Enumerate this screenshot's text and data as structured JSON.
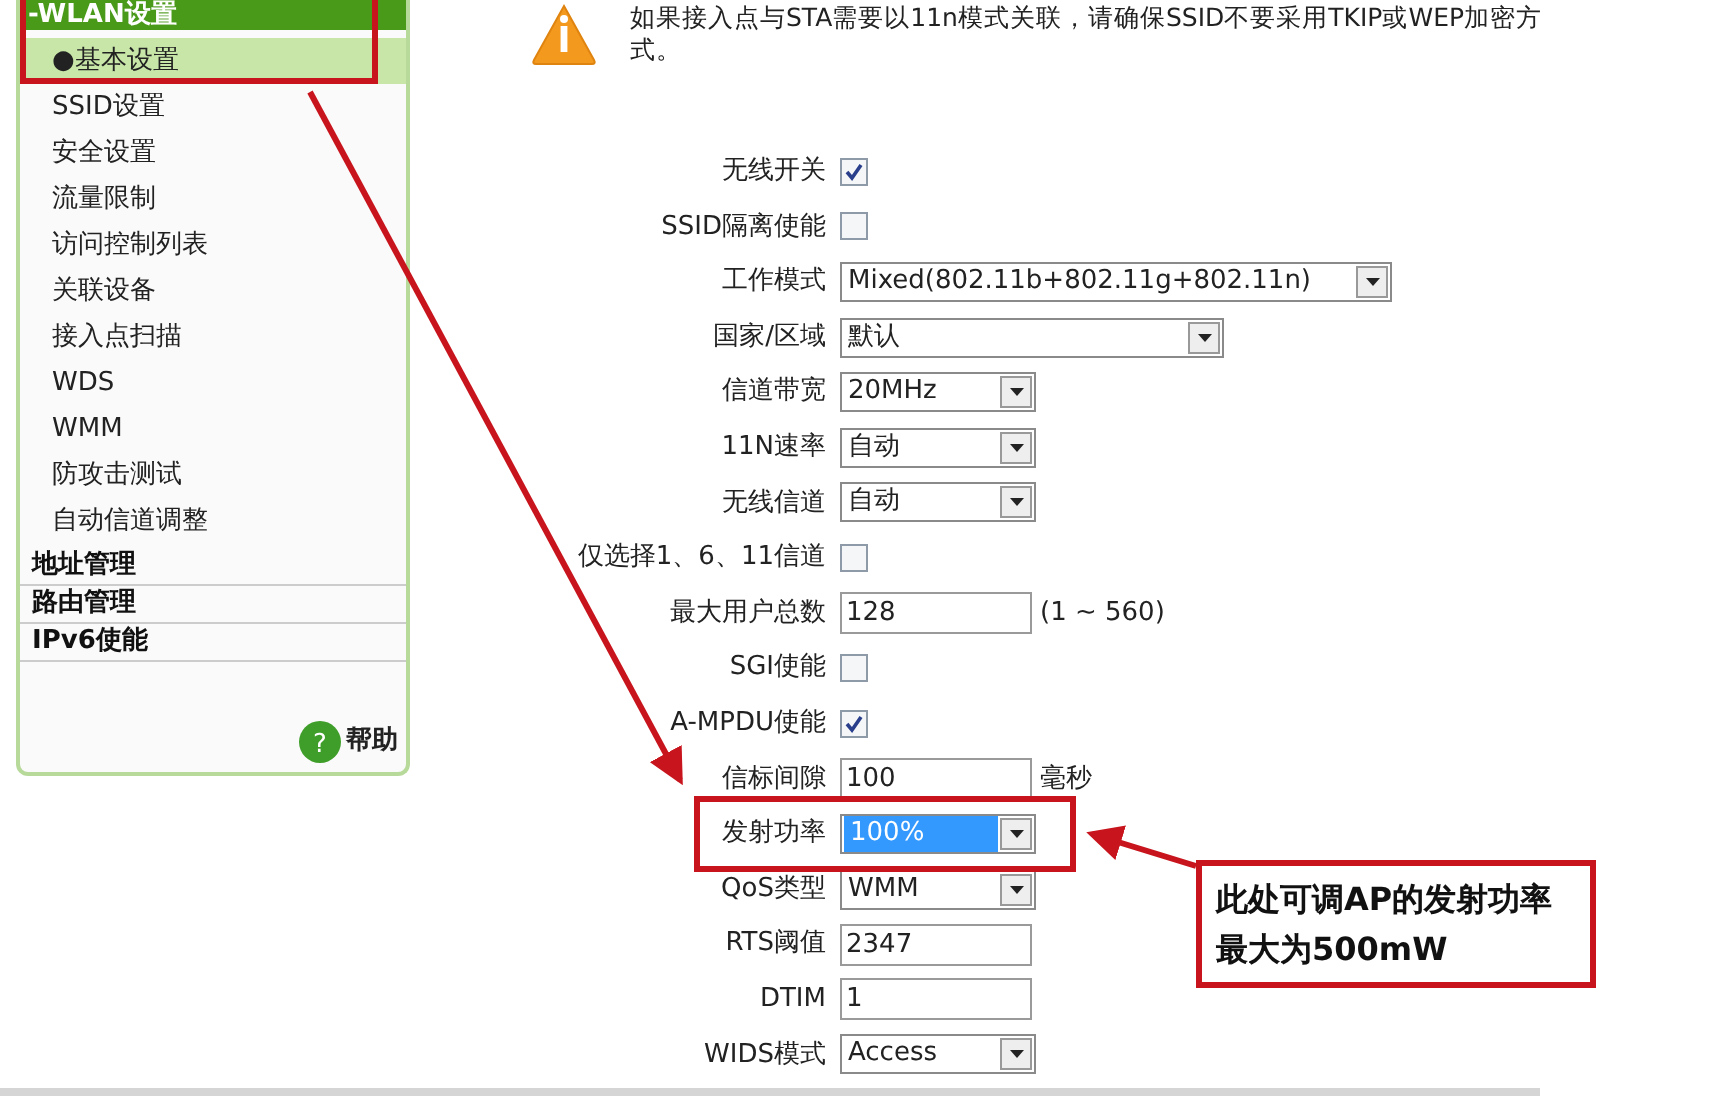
{
  "sidebar": {
    "header": "-WLAN设置",
    "items": [
      {
        "label": "●基本设置",
        "selected": true
      },
      {
        "label": "SSID设置",
        "selected": false
      },
      {
        "label": "安全设置",
        "selected": false
      },
      {
        "label": "流量限制",
        "selected": false
      },
      {
        "label": "访问控制列表",
        "selected": false
      },
      {
        "label": "关联设备",
        "selected": false
      },
      {
        "label": "接入点扫描",
        "selected": false
      },
      {
        "label": "WDS",
        "selected": false
      },
      {
        "label": "WMM",
        "selected": false
      },
      {
        "label": "防攻击测试",
        "selected": false
      },
      {
        "label": "自动信道调整",
        "selected": false
      }
    ],
    "sections": [
      "地址管理",
      "路由管理",
      "IPv6使能"
    ],
    "help_glyph": "?",
    "help": "帮助"
  },
  "notice": "如果接入点与STA需要以11n模式关联，请确保SSID不要采用TKIP或WEP加密方式。",
  "fields": [
    {
      "kind": "checkbox",
      "label": "无线开关",
      "checked": true
    },
    {
      "kind": "checkbox",
      "label": "SSID隔离使能",
      "checked": false
    },
    {
      "kind": "select",
      "label": "工作模式",
      "value": "Mixed(802.11b+802.11g+802.11n)",
      "focused": false
    },
    {
      "kind": "select",
      "label": "国家/区域",
      "value": "默认",
      "focused": false
    },
    {
      "kind": "select",
      "label": "信道带宽",
      "value": "20MHz",
      "focused": false
    },
    {
      "kind": "select",
      "label": "11N速率",
      "value": "自动",
      "focused": false
    },
    {
      "kind": "select",
      "label": "无线信道",
      "value": "自动",
      "focused": false
    },
    {
      "kind": "checkbox",
      "label": "仅选择1、6、11信道",
      "checked": false
    },
    {
      "kind": "text",
      "label": "最大用户总数",
      "value": "128",
      "suffix": "(1 ~ 560)"
    },
    {
      "kind": "checkbox",
      "label": "SGI使能",
      "checked": false
    },
    {
      "kind": "checkbox",
      "label": "A-MPDU使能",
      "checked": true
    },
    {
      "kind": "text",
      "label": "信标间隙",
      "value": "100",
      "suffix": "毫秒"
    },
    {
      "kind": "select",
      "label": "发射功率",
      "value": "100%",
      "focused": true
    },
    {
      "kind": "select",
      "label": "QoS类型",
      "value": "WMM",
      "focused": false
    },
    {
      "kind": "text",
      "label": "RTS阈值",
      "value": "2347"
    },
    {
      "kind": "text",
      "label": "DTIM",
      "value": "1"
    },
    {
      "kind": "select",
      "label": "WIDS模式",
      "value": "Access",
      "focused": false
    }
  ],
  "callout": [
    "此处可调AP的发射功率",
    "最大为500mW"
  ]
}
